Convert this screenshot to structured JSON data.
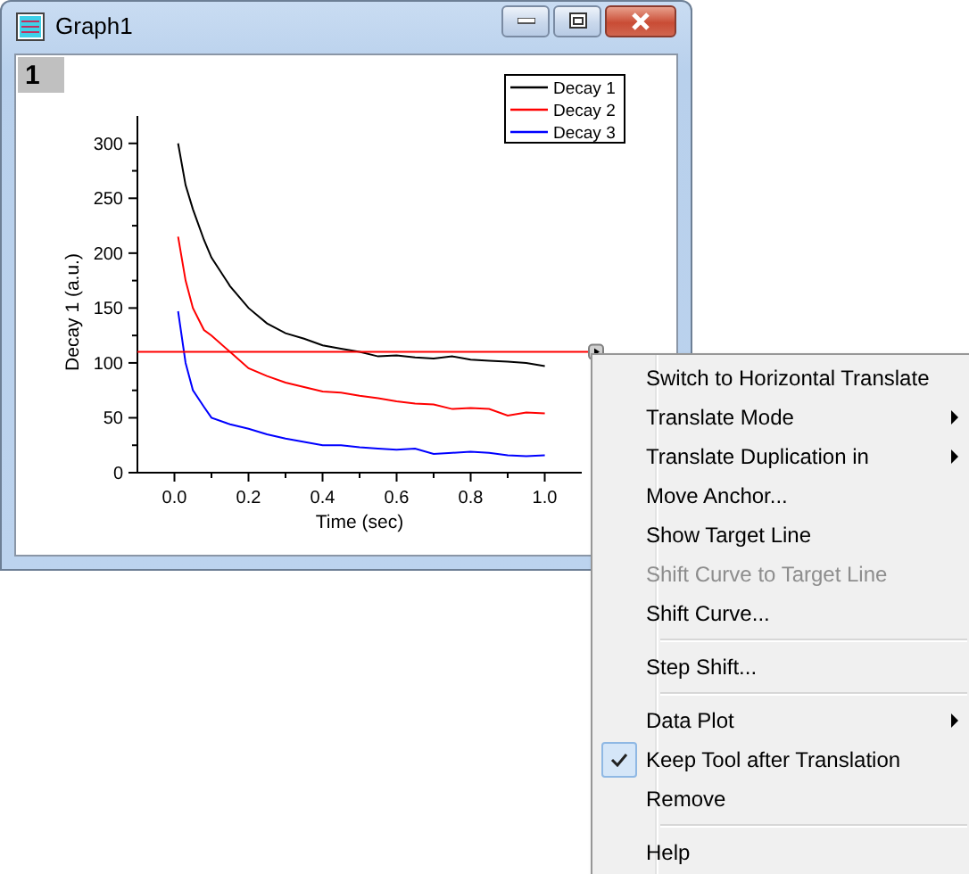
{
  "window": {
    "title": "Graph1",
    "layer": "1"
  },
  "graph": {
    "chart_data": {
      "type": "line",
      "xlabel": "Time (sec)",
      "ylabel": "Decay 1 (a.u.)",
      "x": [
        0.01,
        0.03,
        0.05,
        0.08,
        0.1,
        0.15,
        0.2,
        0.25,
        0.3,
        0.35,
        0.4,
        0.45,
        0.5,
        0.55,
        0.6,
        0.65,
        0.7,
        0.75,
        0.8,
        0.85,
        0.9,
        0.95,
        1.0
      ],
      "series": [
        {
          "name": "Decay 1",
          "color": "#000000",
          "values": [
            300,
            262,
            240,
            212,
            196,
            170,
            150,
            136,
            127,
            122,
            116,
            113,
            110,
            106,
            107,
            105,
            104,
            106,
            103,
            102,
            101,
            100,
            97
          ]
        },
        {
          "name": "Decay 2",
          "color": "#ff0000",
          "values": [
            215,
            175,
            150,
            130,
            125,
            110,
            95,
            88,
            82,
            78,
            74,
            73,
            70,
            68,
            65,
            63,
            62,
            58,
            59,
            58,
            52,
            55,
            54
          ]
        },
        {
          "name": "Decay 3",
          "color": "#0000ff",
          "values": [
            147,
            100,
            75,
            60,
            50,
            44,
            40,
            35,
            31,
            28,
            25,
            25,
            23,
            22,
            21,
            22,
            17,
            18,
            19,
            18,
            16,
            15,
            16
          ]
        }
      ],
      "xlim": [
        -0.1,
        1.1
      ],
      "ylim": [
        0,
        325
      ],
      "xticks": [
        {
          "value": 0,
          "label": "0.0"
        },
        {
          "value": 0.2,
          "label": "0.2"
        },
        {
          "value": 0.4,
          "label": "0.4"
        },
        {
          "value": 0.6,
          "label": "0.6"
        },
        {
          "value": 0.8,
          "label": "0.8"
        },
        {
          "value": 1,
          "label": "1.0"
        }
      ],
      "yticks": [
        0,
        50,
        100,
        150,
        200,
        250,
        300
      ],
      "ref_lines": [
        {
          "axis": "y",
          "value": 110,
          "color": "#ff0000"
        }
      ],
      "legend": "upper right"
    }
  },
  "context_menu": {
    "items": [
      {
        "kind": "item",
        "label": "Switch to Horizontal Translate",
        "disabled": false,
        "submenu": false,
        "checked": false
      },
      {
        "kind": "item",
        "label": "Translate Mode",
        "disabled": false,
        "submenu": true,
        "checked": false
      },
      {
        "kind": "item",
        "label": "Translate Duplication in",
        "disabled": false,
        "submenu": true,
        "checked": false
      },
      {
        "kind": "item",
        "label": "Move Anchor...",
        "disabled": false,
        "submenu": false,
        "checked": false
      },
      {
        "kind": "item",
        "label": "Show Target Line",
        "disabled": false,
        "submenu": false,
        "checked": false
      },
      {
        "kind": "item",
        "label": "Shift Curve to Target Line",
        "disabled": true,
        "submenu": false,
        "checked": false
      },
      {
        "kind": "item",
        "label": "Shift Curve...",
        "disabled": false,
        "submenu": false,
        "checked": false
      },
      {
        "kind": "separator"
      },
      {
        "kind": "item",
        "label": "Step Shift...",
        "disabled": false,
        "submenu": false,
        "checked": false
      },
      {
        "kind": "separator"
      },
      {
        "kind": "item",
        "label": "Data Plot",
        "disabled": false,
        "submenu": true,
        "checked": false
      },
      {
        "kind": "item",
        "label": "Keep Tool after Translation",
        "disabled": false,
        "submenu": false,
        "checked": true
      },
      {
        "kind": "item",
        "label": "Remove",
        "disabled": false,
        "submenu": false,
        "checked": false
      },
      {
        "kind": "separator"
      },
      {
        "kind": "item",
        "label": "Help",
        "disabled": false,
        "submenu": false,
        "checked": false
      }
    ]
  }
}
